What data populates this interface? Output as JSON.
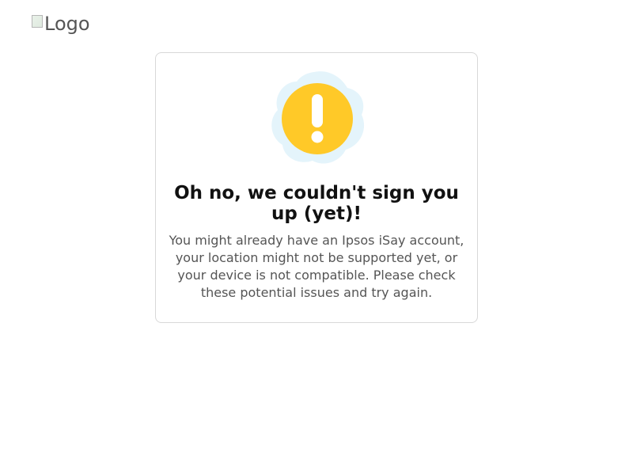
{
  "header": {
    "logo_alt": "Logo"
  },
  "error_card": {
    "icon": "warning-exclamation-icon",
    "icon_color": "#FFC928",
    "icon_bg_color": "#E3F4FA",
    "title": "Oh no, we couldn't sign you up (yet)!",
    "message": "You might already have an Ipsos iSay account, your location might not be supported yet, or your device is not compatible. Please check these potential issues and try again."
  }
}
